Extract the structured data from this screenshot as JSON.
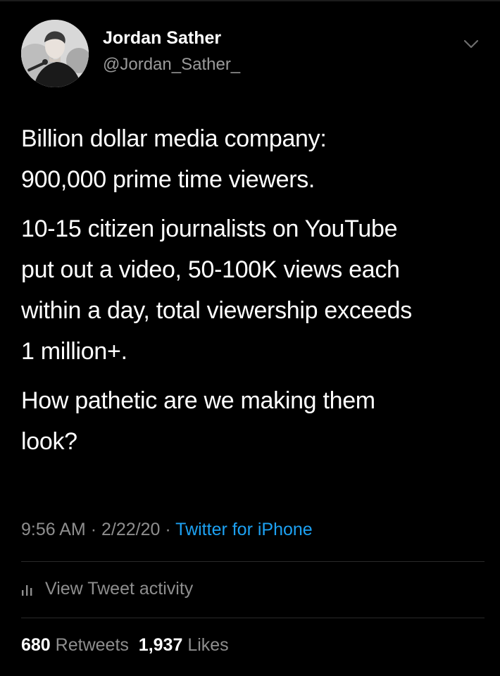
{
  "author": {
    "name": "Jordan Sather",
    "handle": "@Jordan_Sather_",
    "avatar_icon": "profile-photo"
  },
  "tweet": {
    "paragraphs": [
      [
        "Billion dollar media company:",
        "900,000 prime time viewers."
      ],
      [
        "10-15 citizen journalists on YouTube",
        "put out a video, 50-100K views each",
        "within a day, total viewership exceeds",
        "1 million+."
      ],
      [
        "How pathetic are we making them",
        "look?"
      ]
    ]
  },
  "meta": {
    "time": "9:56 AM",
    "separator": "·",
    "date": "2/22/20",
    "source": "Twitter for iPhone"
  },
  "activity": {
    "label": "View Tweet activity",
    "icon": "bar-chart-icon"
  },
  "stats": {
    "retweets_count": "680",
    "retweets_label": "Retweets",
    "likes_count": "1,937",
    "likes_label": "Likes"
  },
  "colors": {
    "background": "#000000",
    "text": "#ffffff",
    "muted": "#8e8e8e",
    "link": "#1da1f2",
    "divider": "#2a2a2a"
  }
}
